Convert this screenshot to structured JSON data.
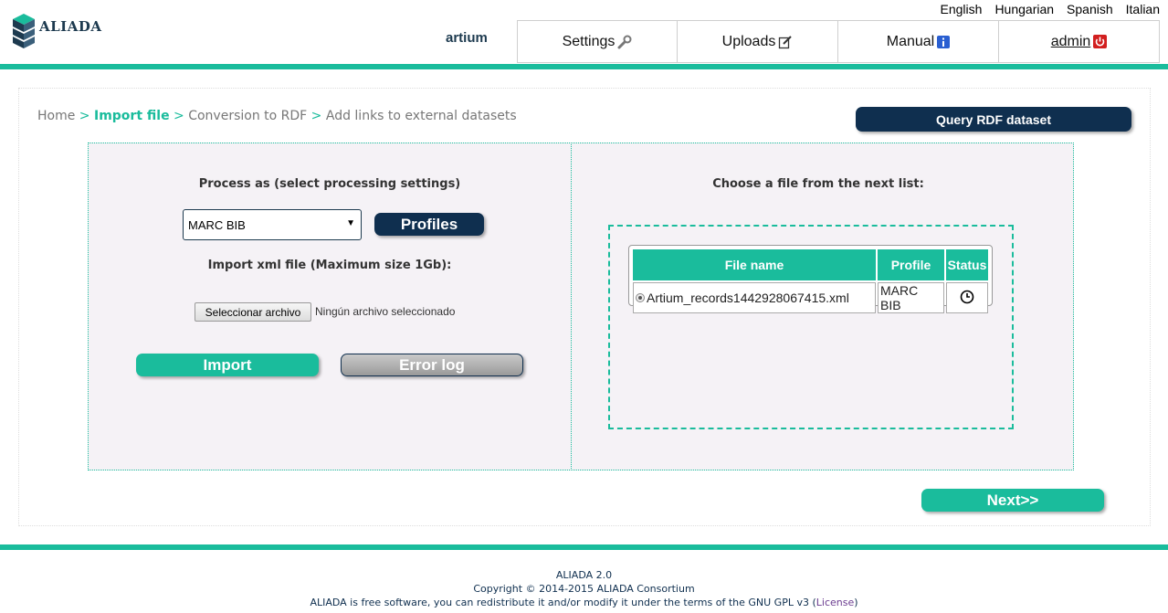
{
  "header": {
    "logo_text": "ALIADA",
    "languages": [
      "English",
      "Hungarian",
      "Spanish",
      "Italian"
    ],
    "username": "artium",
    "nav": [
      {
        "label": "Settings",
        "icon": "wrench-icon"
      },
      {
        "label": "Uploads",
        "icon": "edit-icon"
      },
      {
        "label": "Manual",
        "icon": "info-icon"
      },
      {
        "label": "admin",
        "icon": "power-icon"
      }
    ]
  },
  "breadcrumb": {
    "items": [
      "Home",
      "Import file",
      "Conversion to RDF",
      "Add links to external datasets"
    ],
    "separator": ">",
    "active_index": 1
  },
  "buttons": {
    "query": "Query RDF dataset",
    "profiles": "Profiles",
    "import": "Import",
    "error_log": "Error log",
    "next": "Next>>"
  },
  "left": {
    "process_label": "Process as (select processing settings)",
    "select_value": "MARC BIB",
    "import_label": "Import xml file (Maximum size 1Gb):",
    "file_button": "Seleccionar archivo",
    "file_status": "Ningún archivo seleccionado"
  },
  "right": {
    "choose_label": "Choose a file from the next list:",
    "table": {
      "headers": [
        "File name",
        "Profile",
        "Status"
      ],
      "rows": [
        {
          "file_name": "Artium_records1442928067415.xml",
          "profile": "MARC BIB",
          "status_icon": "clock-icon"
        }
      ]
    }
  },
  "footer": {
    "line1": "ALIADA 2.0",
    "line2": "Copyright © 2014-2015 ALIADA Consortium",
    "line3_prefix": "ALIADA is free software, you can redistribute it and/or modify it under the terms of the GNU GPL v3 (",
    "license_link": "License",
    "line3_suffix": ")"
  },
  "colors": {
    "accent": "#1abc9c",
    "navy": "#0f2f4f",
    "panel_bg": "#f5f2f6"
  }
}
